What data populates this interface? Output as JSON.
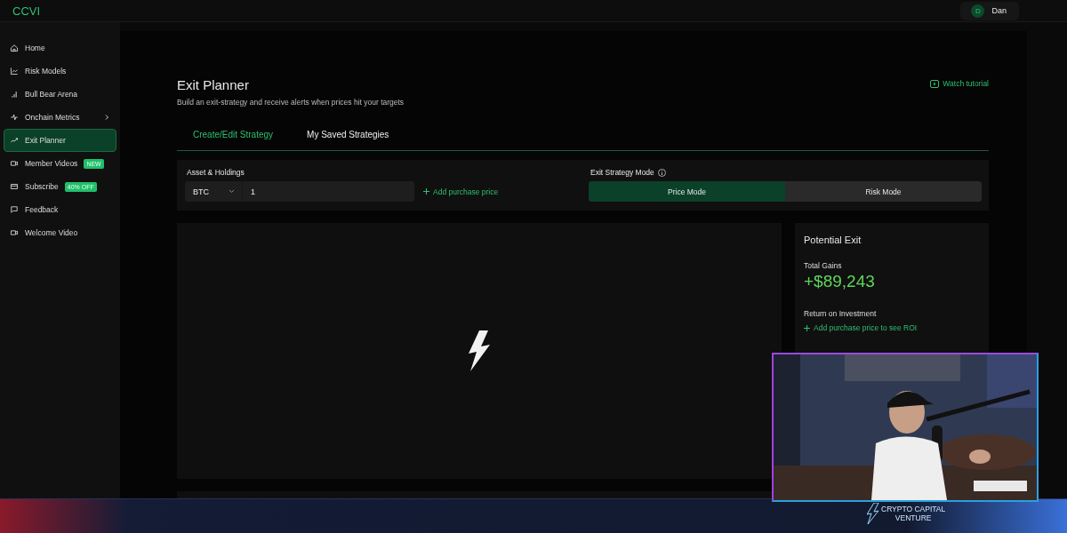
{
  "app": {
    "logo": "CCVI"
  },
  "user": {
    "initial": "D",
    "name": "Dan"
  },
  "sidebar": {
    "items": [
      {
        "label": "Home",
        "selected": false,
        "has_submenu": false
      },
      {
        "label": "Risk Models",
        "selected": false,
        "has_submenu": false
      },
      {
        "label": "Bull Bear Arena",
        "selected": false,
        "has_submenu": false
      },
      {
        "label": "Onchain Metrics",
        "selected": false,
        "has_submenu": true
      },
      {
        "label": "Exit Planner",
        "selected": true,
        "has_submenu": false
      },
      {
        "label": "Member Videos",
        "selected": false,
        "has_submenu": false,
        "badge": "NEW"
      },
      {
        "label": "Subscribe",
        "selected": false,
        "has_submenu": false,
        "badge": "40% OFF"
      },
      {
        "label": "Feedback",
        "selected": false,
        "has_submenu": false
      },
      {
        "label": "Welcome Video",
        "selected": false,
        "has_submenu": false
      }
    ]
  },
  "page": {
    "title": "Exit Planner",
    "subtitle": "Build an exit-strategy and receive alerts when prices hit your targets",
    "watch_tutorial": "Watch tutorial"
  },
  "tabs": [
    {
      "label": "Create/Edit Strategy",
      "selected": true
    },
    {
      "label": "My Saved Strategies",
      "selected": false
    }
  ],
  "holdings": {
    "label": "Asset & Holdings",
    "asset": "BTC",
    "amount": "1",
    "add_purchase": "Add purchase price"
  },
  "mode": {
    "label": "Exit Strategy Mode",
    "options": [
      {
        "label": "Price Mode",
        "selected": true
      },
      {
        "label": "Risk Mode",
        "selected": false
      }
    ]
  },
  "potential_exit": {
    "title": "Potential Exit",
    "total_gains_label": "Total Gains",
    "total_gains": "+$89,243",
    "roi_label": "Return on Investment",
    "roi_link": "Add purchase price to see ROI"
  },
  "stream_overlay": {
    "logo_lines": [
      "CRYPTO CAPITAL",
      "VENTURE"
    ]
  }
}
